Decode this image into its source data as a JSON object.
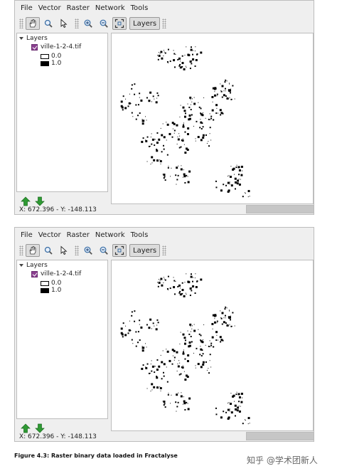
{
  "window": {
    "menu": [
      "File",
      "Vector",
      "Raster",
      "Network",
      "Tools"
    ],
    "toolbar": {
      "tools": [
        {
          "icon": "pan-hand-icon",
          "active": true
        },
        {
          "icon": "zoom-magnifier-icon",
          "active": false
        },
        {
          "icon": "select-arrow-icon",
          "active": false
        },
        {
          "icon": "zoom-in-icon",
          "active": false
        },
        {
          "icon": "zoom-out-icon",
          "active": false
        },
        {
          "icon": "zoom-full-extent-icon",
          "active": true
        }
      ],
      "layers_label": "Layers"
    },
    "layer_tree": {
      "root_label": "Layers",
      "layer_name": "ville-1-2-4.tif",
      "checked": true,
      "legend": [
        {
          "label": "0.0",
          "color": "#ffffff"
        },
        {
          "label": "1.0",
          "color": "#000000"
        }
      ]
    },
    "arrow_buttons": [
      "move-up-arrow-icon",
      "move-down-arrow-icon"
    ],
    "status": {
      "coordinates": "X: 672.396 - Y: -148.113"
    }
  },
  "caption": "Figure 4.3: Raster binary data loaded in Fractalyse",
  "watermark": "知乎 @学术团新人",
  "colors": {
    "checkbox": "#8a3f8f",
    "arrow_green": "#2e9a33",
    "window_bg": "#efefef"
  }
}
